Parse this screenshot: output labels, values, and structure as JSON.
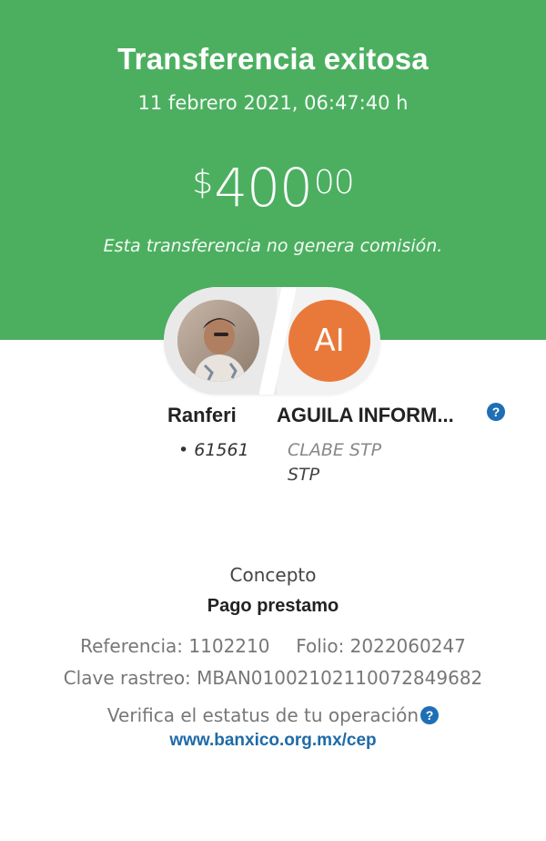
{
  "header": {
    "title": "Transferencia exitosa",
    "datetime": "11 febrero 2021, 06:47:40 h",
    "amount": {
      "currency": "$",
      "integer": "400",
      "decimals": "00"
    },
    "commission_note": "Esta transferencia no genera comisión.",
    "background_color": "#4caf60"
  },
  "sender": {
    "name": "Ranferi",
    "account": "• 61561",
    "avatar_icon": "user-photo"
  },
  "recipient": {
    "initials": "AI",
    "name": "AGUILA INFORM...",
    "account_type": "CLABE STP",
    "bank": "STP",
    "avatar_color": "#e9793a",
    "help_icon": "question-icon"
  },
  "details": {
    "concept_label": "Concepto",
    "concept_value": "Pago prestamo",
    "reference": "Referencia: 1102210",
    "folio": "Folio: 2022060247",
    "clave_rastreo": "Clave rastreo: MBAN01002102110072849682",
    "verify_text": "Verifica el estatus de tu operación",
    "verify_link": "www.banxico.org.mx/cep",
    "link_color": "#1f6aa8"
  }
}
